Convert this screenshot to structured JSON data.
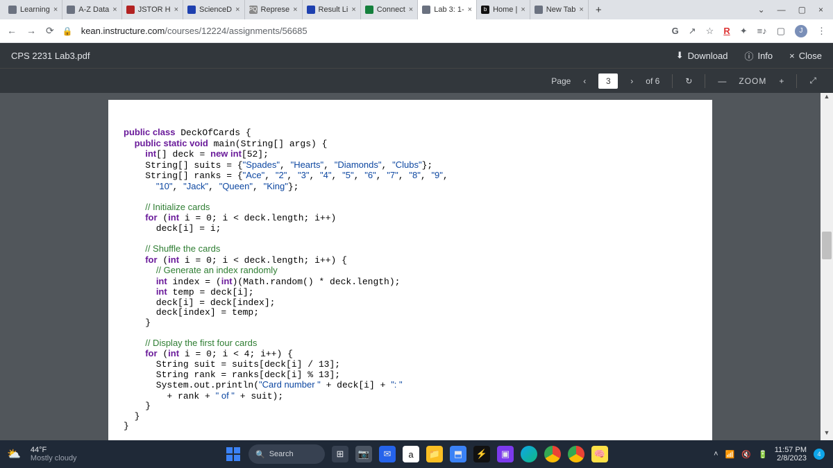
{
  "tabs": [
    {
      "label": "Learning"
    },
    {
      "label": "A-Z Data"
    },
    {
      "label": "JSTOR H"
    },
    {
      "label": "ScienceD"
    },
    {
      "label": "Represe"
    },
    {
      "label": "Result Li"
    },
    {
      "label": "Connect"
    },
    {
      "label": "Lab 3: 1-"
    },
    {
      "label": "Home |"
    },
    {
      "label": "New Tab"
    }
  ],
  "url": {
    "host": "kean.instructure.com",
    "path": "/courses/12224/assignments/56685"
  },
  "pdf": {
    "title": "CPS 2231 Lab3.pdf",
    "download": "Download",
    "info": "Info",
    "close": "Close",
    "page_label": "Page",
    "page_current": "3",
    "page_total": "of 6",
    "zoom_label": "ZOOM"
  },
  "code_lines": [
    {
      "t": "public class ",
      "k1": "public class",
      "r": " DeckOfCards {"
    },
    {
      "indent": 1,
      "k1": "public static void",
      "r": " main(String[] args) {"
    },
    {
      "indent": 2,
      "k1": "int",
      "r": "[] deck = ",
      "k2": "new int",
      "r2": "[52];"
    },
    {
      "indent": 2,
      "plain": "String[] suits = {\"Spades\", \"Hearts\", \"Diamonds\", \"Clubs\"};",
      "str": true
    },
    {
      "indent": 2,
      "plain": "String[] ranks = {\"Ace\", \"2\", \"3\", \"4\", \"5\", \"6\", \"7\", \"8\", \"9\",",
      "str": true
    },
    {
      "indent": 3,
      "plain": "\"10\", \"Jack\", \"Queen\", \"King\"};",
      "str": true
    },
    {
      "blank": true
    },
    {
      "indent": 2,
      "cm": "// Initialize cards"
    },
    {
      "indent": 2,
      "k1": "for",
      "r": " (",
      "k2": "int",
      "r2": " i = 0; i < deck.length; i++)"
    },
    {
      "indent": 3,
      "plain": "deck[i] = i;"
    },
    {
      "blank": true
    },
    {
      "indent": 2,
      "cm": "// Shuffle the cards"
    },
    {
      "indent": 2,
      "k1": "for",
      "r": " (",
      "k2": "int",
      "r2": " i = 0; i < deck.length; i++) {"
    },
    {
      "indent": 3,
      "cm": "// Generate an index randomly"
    },
    {
      "indent": 3,
      "k1": "int",
      "r": " index = (",
      "k2": "int",
      "r2": ")(Math.random() * deck.length);"
    },
    {
      "indent": 3,
      "k1": "int",
      "r": " temp = deck[i];"
    },
    {
      "indent": 3,
      "plain": "deck[i] = deck[index];"
    },
    {
      "indent": 3,
      "plain": "deck[index] = temp;"
    },
    {
      "indent": 2,
      "plain": "}"
    },
    {
      "blank": true
    },
    {
      "indent": 2,
      "cm": "// Display the first four cards"
    },
    {
      "indent": 2,
      "k1": "for",
      "r": " (",
      "k2": "int",
      "r2": " i = 0; i < 4; i++) {"
    },
    {
      "indent": 3,
      "plain": "String suit = suits[deck[i] / 13];"
    },
    {
      "indent": 3,
      "plain": "String rank = ranks[deck[i] % 13];"
    },
    {
      "indent": 3,
      "plain": "System.out.println(\"Card number \" + deck[i] + \": \"",
      "str": true
    },
    {
      "indent": 4,
      "plain": "+ rank + \" of \" + suit);",
      "str": true
    },
    {
      "indent": 2,
      "plain": "}"
    },
    {
      "indent": 1,
      "plain": "}"
    },
    {
      "indent": 0,
      "plain": "}"
    }
  ],
  "taskbar": {
    "temp": "44°F",
    "cond": "Mostly cloudy",
    "search": "Search",
    "time": "11:57 PM",
    "date": "2/8/2023"
  }
}
